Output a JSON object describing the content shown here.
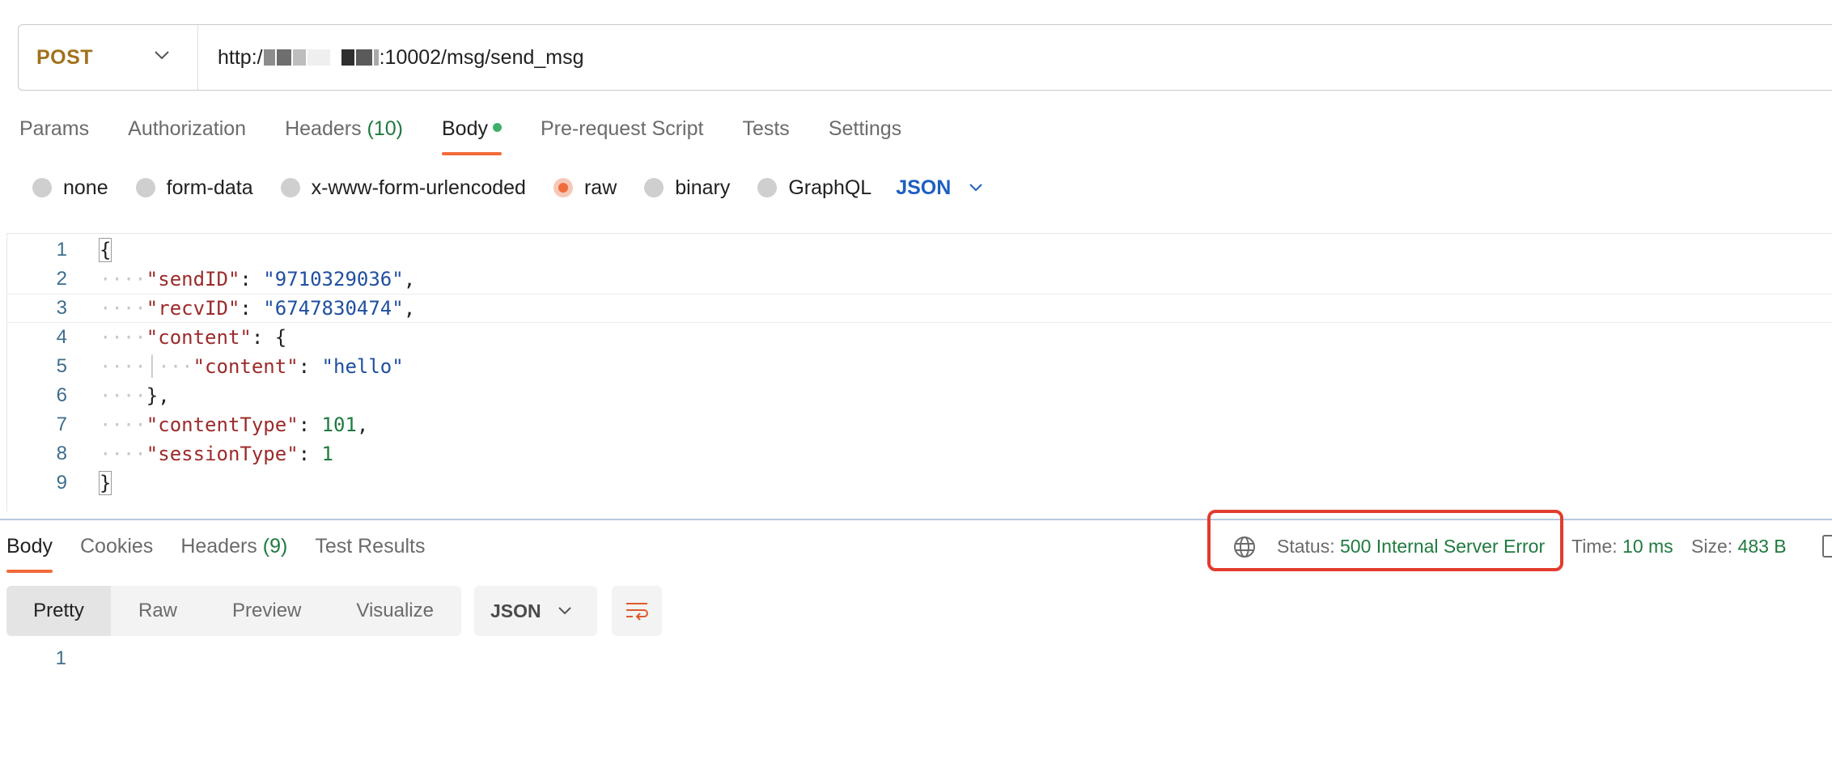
{
  "request": {
    "method": "POST",
    "url_prefix": "http:/",
    "url_suffix": ":10002/msg/send_msg"
  },
  "request_tabs": [
    {
      "label": "Params"
    },
    {
      "label": "Authorization"
    },
    {
      "label": "Headers",
      "count": "(10)"
    },
    {
      "label": "Body",
      "active": true
    },
    {
      "label": "Pre-request Script"
    },
    {
      "label": "Tests"
    },
    {
      "label": "Settings"
    }
  ],
  "body_modes": [
    {
      "label": "none"
    },
    {
      "label": "form-data"
    },
    {
      "label": "x-www-form-urlencoded"
    },
    {
      "label": "raw",
      "selected": true
    },
    {
      "label": "binary"
    },
    {
      "label": "GraphQL"
    }
  ],
  "body_language": "JSON",
  "code_lines": [
    {
      "n": "1",
      "indent": "",
      "parts": [
        [
          "p",
          "{"
        ]
      ]
    },
    {
      "n": "2",
      "indent": "····",
      "parts": [
        [
          "k",
          "\"sendID\""
        ],
        [
          "p",
          ": "
        ],
        [
          "s",
          "\"9710329036\""
        ],
        [
          "p",
          ","
        ]
      ]
    },
    {
      "n": "3",
      "indent": "····",
      "parts": [
        [
          "k",
          "\"recvID\""
        ],
        [
          "p",
          ": "
        ],
        [
          "s",
          "\"6747830474\""
        ],
        [
          "p",
          ","
        ]
      ]
    },
    {
      "n": "4",
      "indent": "····",
      "parts": [
        [
          "k",
          "\"content\""
        ],
        [
          "p",
          ": "
        ],
        [
          "p",
          "{"
        ]
      ]
    },
    {
      "n": "5",
      "indent": "····│···",
      "parts": [
        [
          "k",
          "\"content\""
        ],
        [
          "p",
          ": "
        ],
        [
          "s",
          "\"hello\""
        ]
      ]
    },
    {
      "n": "6",
      "indent": "····",
      "parts": [
        [
          "p",
          "},"
        ]
      ]
    },
    {
      "n": "7",
      "indent": "····",
      "parts": [
        [
          "k",
          "\"contentType\""
        ],
        [
          "p",
          ": "
        ],
        [
          "n",
          "101"
        ],
        [
          "p",
          ","
        ]
      ]
    },
    {
      "n": "8",
      "indent": "····",
      "parts": [
        [
          "k",
          "\"sessionType\""
        ],
        [
          "p",
          ": "
        ],
        [
          "n",
          "1"
        ]
      ]
    },
    {
      "n": "9",
      "indent": "",
      "parts": [
        [
          "p",
          "}"
        ]
      ]
    }
  ],
  "response_tabs": [
    {
      "label": "Body",
      "active": true
    },
    {
      "label": "Cookies"
    },
    {
      "label": "Headers",
      "count": "(9)"
    },
    {
      "label": "Test Results"
    }
  ],
  "response_status": {
    "status_label": "Status:",
    "status_value": "500 Internal Server Error",
    "time_label": "Time:",
    "time_value": "10 ms",
    "size_label": "Size:",
    "size_value": "483 B"
  },
  "response_views": [
    {
      "label": "Pretty",
      "active": true
    },
    {
      "label": "Raw"
    },
    {
      "label": "Preview"
    },
    {
      "label": "Visualize"
    }
  ],
  "response_format": "JSON",
  "response_line_number": "1",
  "colors": {
    "accent": "#f26b3a",
    "method_post": "#a0721d",
    "status_ok_text": "#1f7a3f",
    "highlight_box": "#e33b2e",
    "json_blue": "#1e5fc2"
  }
}
